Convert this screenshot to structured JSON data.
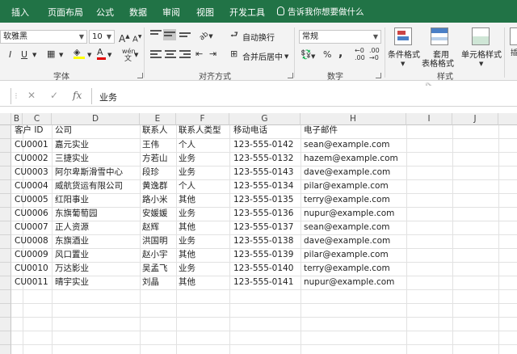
{
  "ribbon_tabs": [
    "插入",
    "页面布局",
    "公式",
    "数据",
    "审阅",
    "视图",
    "开发工具"
  ],
  "tell_me": "告诉我你想要做什么",
  "font_group": {
    "font_name": "软雅黑",
    "font_size": "10",
    "grow_label": "A",
    "shrink_label": "A",
    "italic": "I",
    "underline": "U",
    "font_color": "A",
    "phonetic": "wén",
    "label": "字体"
  },
  "align_group": {
    "orientation": "ab",
    "wrap_label": "自动换行",
    "merge_label": "合并后居中",
    "label": "对齐方式"
  },
  "number_group": {
    "format": "常规",
    "percent": "%",
    "comma": ",",
    "inc_decimal": ".00",
    "dec_decimal": ".00",
    "label": "数字"
  },
  "styles_group": {
    "conditional": "条件格式",
    "table_format_1": "套用",
    "table_format_2": "表格格式",
    "cell_styles": "单元格样式",
    "label": "样式"
  },
  "formula_bar": {
    "value": "业务",
    "fx": "fx",
    "cancel": "✕",
    "confirm": "✓"
  },
  "columns": [
    "B",
    "C",
    "D",
    "E",
    "F",
    "G",
    "H",
    "I",
    "J"
  ],
  "headers": [
    "客户 ID",
    "公司",
    "联系人",
    "联系人类型",
    "移动电话",
    "电子邮件"
  ],
  "rows": [
    [
      "CU0001",
      "嘉元实业",
      "王伟",
      "个人",
      "123-555-0142",
      "sean@example.com"
    ],
    [
      "CU0002",
      "三捷实业",
      "方若山",
      "业务",
      "123-555-0132",
      "hazem@example.com"
    ],
    [
      "CU0003",
      "阿尔卑斯滑雪中心",
      "段珍",
      "业务",
      "123-555-0143",
      "dave@example.com"
    ],
    [
      "CU0004",
      "威航货运有限公司",
      "黄逸群",
      "个人",
      "123-555-0134",
      "pilar@example.com"
    ],
    [
      "CU0005",
      "红阳事业",
      "路小米",
      "其他",
      "123-555-0135",
      "terry@example.com"
    ],
    [
      "CU0006",
      "东旗葡萄园",
      "安媛媛",
      "业务",
      "123-555-0136",
      "nupur@example.com"
    ],
    [
      "CU0007",
      "正人资源",
      "赵辉",
      "其他",
      "123-555-0137",
      "sean@example.com"
    ],
    [
      "CU0008",
      "东旗酒业",
      "洪国明",
      "业务",
      "123-555-0138",
      "dave@example.com"
    ],
    [
      "CU0009",
      "风口置业",
      "赵小宇",
      "其他",
      "123-555-0139",
      "pilar@example.com"
    ],
    [
      "CU0010",
      "万达影业",
      "吴孟飞",
      "业务",
      "123-555-0140",
      "terry@example.com"
    ],
    [
      "CU0011",
      "晴宇实业",
      "刘晶",
      "其他",
      "123-555-0141",
      "nupur@example.com"
    ]
  ],
  "colors": {
    "ribbon_green": "#217346",
    "ribbon_bg": "#f3f3f3",
    "header_bg": "#efefef",
    "gridline": "#e2e2e2"
  }
}
